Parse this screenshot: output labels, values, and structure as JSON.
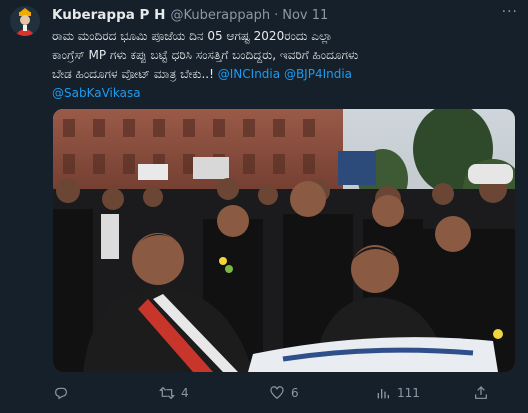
{
  "author": {
    "name": "Kuberappa P H",
    "handle": "@Kuberappaph",
    "separator": "·",
    "date": "Nov 11"
  },
  "menu": {
    "label": "···"
  },
  "tweet": {
    "line1": "ರಾಮ ಮಂದಿರದ ಭೂಮಿ ಪೂಜೆಯ ದಿನ 05 ಆಗಷ್ಟ 2020ರಂದು ಎಲ್ಲಾ",
    "line2": "ಕಾಂಗ್ರೆಸ್ MP ಗಳು ಕಪ್ಪು ಬಟ್ಟೆ ಧರಿಸಿ ಸಂಸತ್ತಿಗೆ ಬಂದಿದ್ದರು, ಇವರಿಗೆ ಹಿಂದೂಗಳು",
    "line3": "ಬೇಡ ಹಿಂದೂಗಳ ವೋಟ್ ಮಾತ್ರ ಬೇಕು..!",
    "mention1": "@INCIndia",
    "mention2": "@BJP4India",
    "mention3": "@SabKaVikasa"
  },
  "photo": {
    "description_icon": "protest-photo"
  },
  "actions": {
    "reply_count": "",
    "retweet_count": "4",
    "like_count": "6",
    "views_count": "111",
    "share_count": ""
  },
  "colors": {
    "background": "#15202b",
    "text": "#e7e9ea",
    "muted": "#8b98a5",
    "link": "#1d9bf0"
  }
}
